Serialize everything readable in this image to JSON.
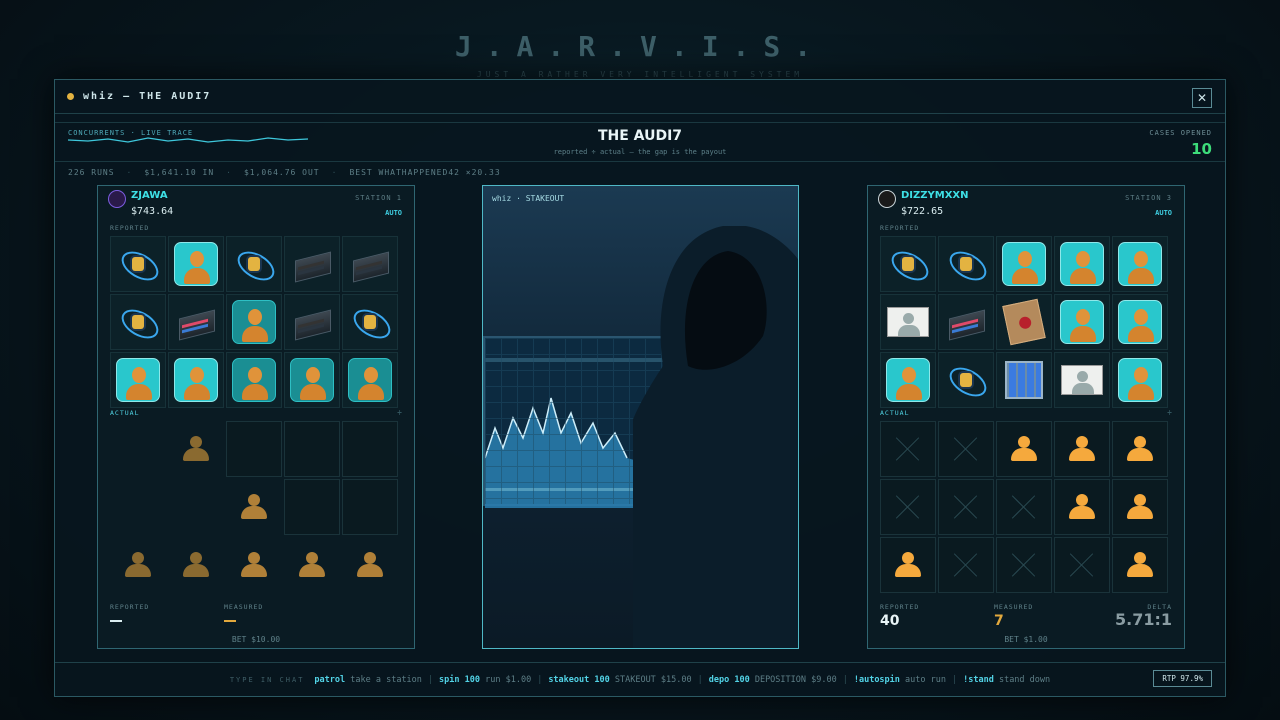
{
  "background": {
    "title": "J.A.R.V.I.S.",
    "subtitle": "JUST A RATHER VERY INTELLIGENT SYSTEM"
  },
  "window": {
    "title": "whiz — THE AUDI7",
    "close_icon": "close-icon"
  },
  "header": {
    "trace_label": "CONCURRENTS · LIVE TRACE",
    "title": "THE AUDI7",
    "subtitle": "reported ÷ actual — the gap is the payout",
    "cases_label": "CASES OPENED",
    "cases_value": "10"
  },
  "stats": {
    "runs": "226 RUNS",
    "in": "$1,641.10 IN",
    "out": "$1,064.76 OUT",
    "best": "BEST WHATHAPPENED42 ×20.33"
  },
  "stations": [
    {
      "name": "ZJAWA",
      "balance": "$743.64",
      "station_label": "STATION 1",
      "mode": "AUTO",
      "reported_label": "REPORTED",
      "actual_label": "ACTUAL",
      "reported_grid": [
        "atom",
        "person",
        "atom",
        "server-dim",
        "server-dim",
        "atom",
        "server",
        "person-dark",
        "server-dim",
        "atom",
        "person",
        "person",
        "person-dark",
        "person-dark",
        "person-dark"
      ],
      "actual_grid": [
        "dim",
        "ghost-faded",
        "cell",
        "cell",
        "cell",
        "dim",
        "dim",
        "ghost-mid",
        "cell",
        "cell",
        "ghost-faded",
        "ghost-faded",
        "ghost-mid",
        "ghost-mid",
        "ghost-mid"
      ],
      "footer": {
        "reported_label": "REPORTED",
        "measured_label": "MEASURED",
        "bet": "BET $10.00"
      }
    },
    {
      "name": "DIZZYMXXN",
      "balance": "$722.65",
      "station_label": "STATION 3",
      "mode": "AUTO",
      "reported_label": "REPORTED",
      "actual_label": "ACTUAL",
      "reported_grid": [
        "atom",
        "atom",
        "person",
        "person",
        "person",
        "id",
        "server",
        "envelope",
        "person",
        "person",
        "person",
        "atom",
        "building",
        "id",
        "person"
      ],
      "actual_grid": [
        "x",
        "x",
        "ghost",
        "ghost",
        "ghost",
        "x",
        "x",
        "x",
        "ghost",
        "ghost",
        "ghost",
        "x",
        "x",
        "x",
        "ghost"
      ],
      "footer": {
        "reported_label": "REPORTED",
        "reported_value": "40",
        "measured_label": "MEASURED",
        "measured_value": "7",
        "delta_label": "DELTA",
        "delta_value": "5.71:1",
        "bet": "BET $1.00"
      }
    }
  ],
  "stakeout": {
    "label": "whiz · STAKEOUT"
  },
  "chat": {
    "type_in": "TYPE IN CHAT",
    "commands": [
      {
        "cmd": "patrol",
        "desc": "take a station"
      },
      {
        "cmd": "spin 100",
        "desc": "run $1.00"
      },
      {
        "cmd": "stakeout 100",
        "desc": "STAKEOUT $15.00"
      },
      {
        "cmd": "depo 100",
        "desc": "DEPOSITION $9.00"
      },
      {
        "cmd": "!autospin",
        "desc": "auto run"
      },
      {
        "cmd": "!stand",
        "desc": "stand down"
      }
    ],
    "rtp": "RTP 97.9%"
  },
  "colors": {
    "accent_cyan": "#3ee0e6",
    "cases_green": "#3ddc7a",
    "measured_orange": "#e3a93d",
    "ghost_orange": "#f5a93d"
  }
}
